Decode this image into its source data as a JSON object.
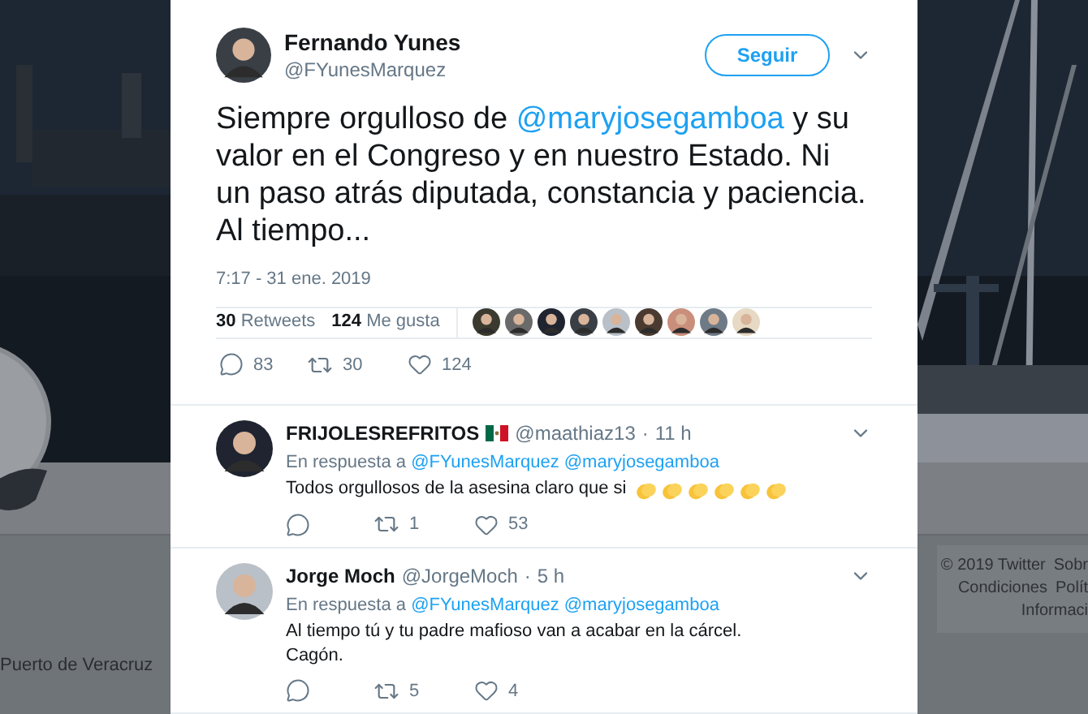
{
  "background": {
    "location": "Puerto de Veracruz",
    "footer_links": [
      "© 2019 Twitter",
      "Sobr",
      "Condiciones",
      "Polít",
      "Informaci"
    ]
  },
  "tweet": {
    "author": {
      "name": "Fernando Yunes",
      "handle": "@FYunesMarquez"
    },
    "follow_button": "Seguir",
    "text_parts": [
      {
        "kind": "text",
        "text": "Siempre orgulloso de "
      },
      {
        "kind": "mention",
        "text": "@maryjosegamboa"
      },
      {
        "kind": "text",
        "text": " y su valor en el Congreso y en nuestro Estado. Ni un paso atrás diputada, constancia y paciencia. Al tiempo..."
      }
    ],
    "timestamp": "7:17 - 31 ene. 2019",
    "stats": [
      {
        "count": "30",
        "label": "Retweets"
      },
      {
        "count": "124",
        "label": "Me gusta"
      }
    ],
    "actions": {
      "replies": "83",
      "retweets": "30",
      "likes": "124"
    }
  },
  "replies": [
    {
      "name": "FRIJOLESREFRITOS",
      "flag": true,
      "handle": "@maathiaz13",
      "separator": "·",
      "time": "11 h",
      "reply_label": "En respuesta a",
      "mentions": [
        "@FYunesMarquez",
        "@maryjosegamboa"
      ],
      "lines": [
        "Todos orgullosos de la asesina claro que si"
      ],
      "emojis": [
        {
          "kind": "clap"
        },
        {
          "kind": "clap"
        },
        {
          "kind": "clap"
        },
        {
          "kind": "clap"
        },
        {
          "kind": "clap"
        },
        {
          "kind": "clap"
        }
      ],
      "retweets": "1",
      "likes": "53"
    },
    {
      "name": "Jorge Moch",
      "flag": false,
      "handle": "@JorgeMoch",
      "separator": "·",
      "time": "5 h",
      "reply_label": "En respuesta a",
      "mentions": [
        "@FYunesMarquez",
        "@maryjosegamboa"
      ],
      "lines": [
        "Al tiempo tú y tu padre mafioso van a acabar en la cárcel.",
        "Cagón."
      ],
      "retweets": "5",
      "likes": "4"
    }
  ]
}
